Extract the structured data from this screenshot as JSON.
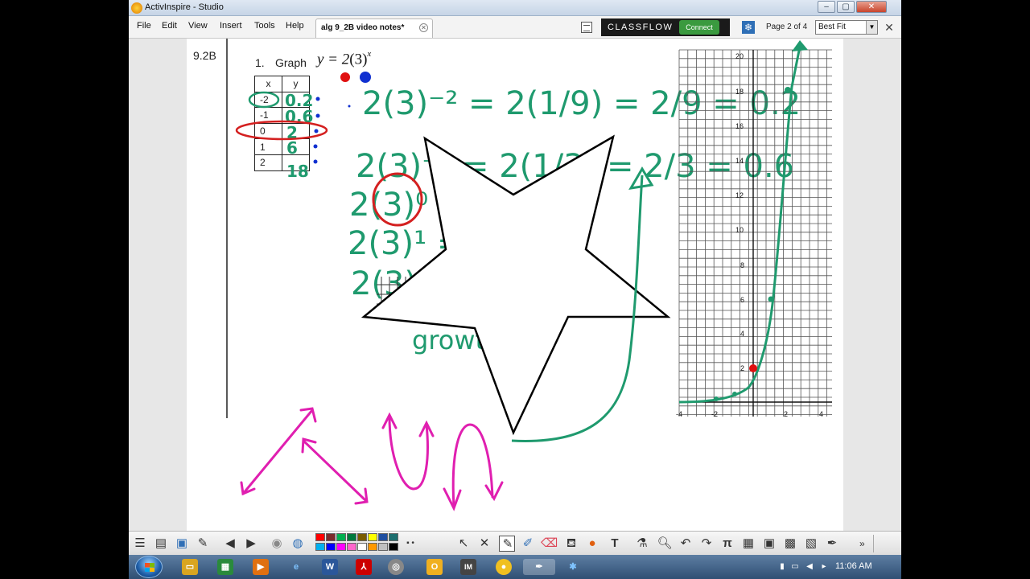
{
  "window": {
    "title": "ActivInspire - Studio",
    "min": "–",
    "max": "▢",
    "close": "✕"
  },
  "menu": [
    "File",
    "Edit",
    "View",
    "Insert",
    "Tools",
    "Help"
  ],
  "tab": {
    "label": "alg 9_2B video notes*",
    "close": "✕"
  },
  "classflow": {
    "brand": "CLASSFLOW",
    "connect": "Connect"
  },
  "page_indicator": "Page 2 of 4",
  "zoom": {
    "value": "Best Fit"
  },
  "worksheet": {
    "section": "9.2B",
    "problem_number": "1.",
    "problem_verb": "Graph",
    "equation": {
      "lhs": "y = 2",
      "base": "(3)",
      "exponent": "x"
    },
    "table": {
      "headers": [
        "x",
        "y"
      ],
      "x_values": [
        "-2",
        "-1",
        "0",
        "1",
        "2"
      ]
    }
  },
  "handwriting": {
    "y_column": [
      "0.2",
      "0.6",
      "2",
      "6",
      "18"
    ],
    "line1": "2(3)⁻² = 2(1/9) = 2/9 = 0.2",
    "line2": "2(3)⁻¹ = 2(1/3) = 2/3 = 0.6",
    "line3": "2(3)⁰ = 2",
    "line4": "2(3)¹ = 6",
    "line5": "2(3)² = 18",
    "note": "growth"
  },
  "graph": {
    "x_ticks": [
      "-4",
      "-2",
      "2",
      "4"
    ],
    "y_ticks": [
      "2",
      "4",
      "6",
      "8",
      "10",
      "12",
      "14",
      "16",
      "18",
      "20"
    ]
  },
  "toolbar": {
    "expand": "»",
    "colors": [
      "#ff0000",
      "#7b2b2b",
      "#00b050",
      "#007a3d",
      "#7a5c00",
      "#ffff00",
      "#1f4fa0",
      "#1c6e6e",
      "#00b0f0",
      "#0000ff",
      "#ff00ff",
      "#ff66cc",
      "#ffffff",
      "#ff9900",
      "#c0c0c0",
      "#000000"
    ],
    "tools": [
      "select",
      "tools",
      "pen",
      "highlighter",
      "eraser",
      "fill",
      "shape",
      "text",
      "clear",
      "zoom",
      "undo",
      "redo",
      "pi",
      "grid",
      "camera",
      "camera-2",
      "video",
      "dropper"
    ]
  },
  "taskbar": {
    "clock": "11:06 AM"
  }
}
